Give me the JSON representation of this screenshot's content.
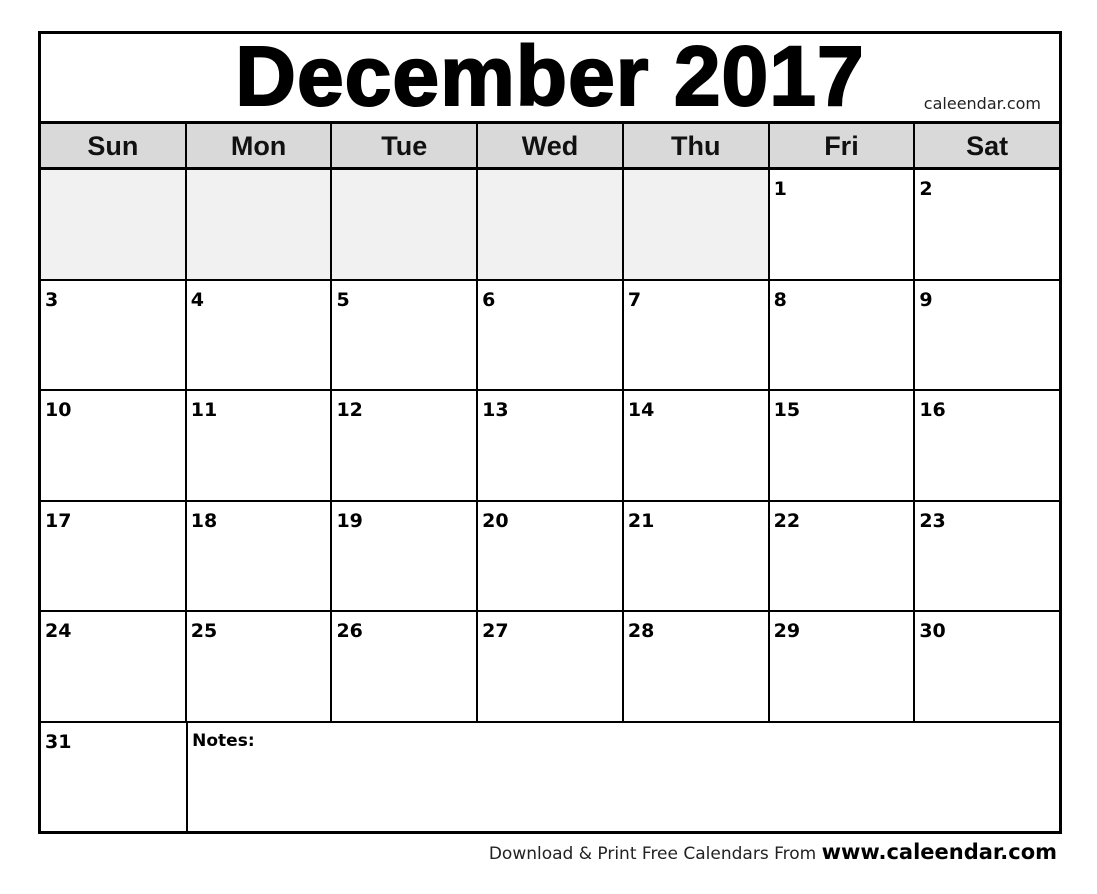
{
  "header": {
    "title": "December 2017",
    "brand": "caleendar.com"
  },
  "weekdays": [
    "Sun",
    "Mon",
    "Tue",
    "Wed",
    "Thu",
    "Fri",
    "Sat"
  ],
  "weeks": [
    [
      "",
      "",
      "",
      "",
      "",
      "1",
      "2"
    ],
    [
      "3",
      "4",
      "5",
      "6",
      "7",
      "8",
      "9"
    ],
    [
      "10",
      "11",
      "12",
      "13",
      "14",
      "15",
      "16"
    ],
    [
      "17",
      "18",
      "19",
      "20",
      "21",
      "22",
      "23"
    ],
    [
      "24",
      "25",
      "26",
      "27",
      "28",
      "29",
      "30"
    ]
  ],
  "last_week": {
    "day": "31",
    "notes_label": "Notes:"
  },
  "footer": {
    "text": "Download  & Print Free Calendars From ",
    "link": "www.caleendar.com"
  },
  "colors": {
    "header_bg": "#d9d9d9",
    "empty_cell_bg": "#f1f1f1",
    "border": "#000000"
  }
}
